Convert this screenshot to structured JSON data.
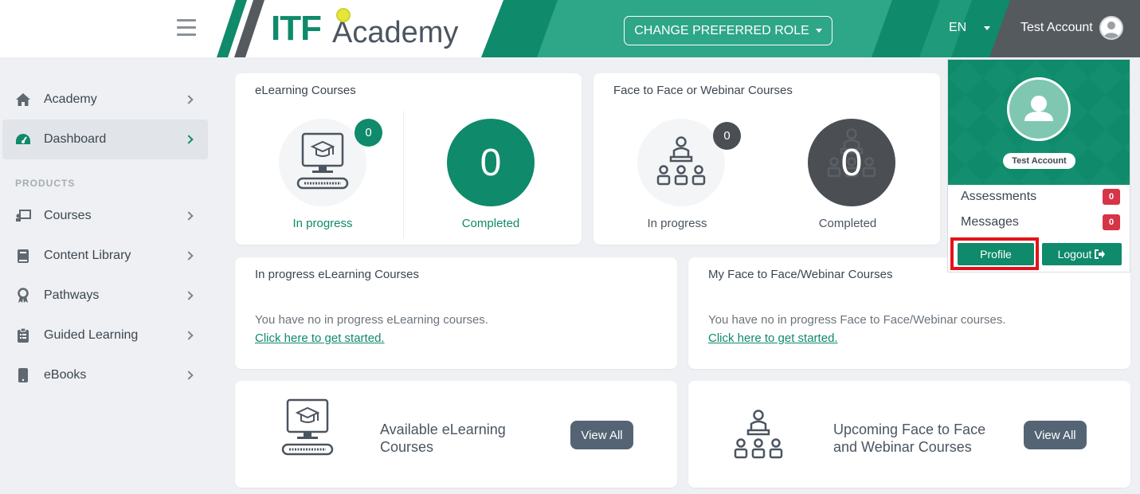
{
  "header": {
    "logo_itf": "ITF",
    "logo_academy": "Academy",
    "role_button": "CHANGE PREFERRED ROLE",
    "language": "EN",
    "account_name": "Test Account",
    "colors": {
      "primary": "#0f8a6a",
      "secondary": "#2ea688",
      "dark": "#555a5f"
    }
  },
  "sidebar": {
    "section_label": "PRODUCTS",
    "items": [
      {
        "label": "Academy",
        "icon": "home-icon"
      },
      {
        "label": "Dashboard",
        "icon": "dashboard-icon"
      },
      {
        "label": "Courses",
        "icon": "courses-icon"
      },
      {
        "label": "Content Library",
        "icon": "book-icon"
      },
      {
        "label": "Pathways",
        "icon": "award-icon"
      },
      {
        "label": "Guided Learning",
        "icon": "clipboard-icon"
      },
      {
        "label": "eBooks",
        "icon": "tablet-icon"
      }
    ]
  },
  "elearning_card": {
    "title": "eLearning Courses",
    "in_progress_count": "0",
    "in_progress_label": "In progress",
    "completed_count": "0",
    "completed_label": "Completed"
  },
  "f2f_card": {
    "title": "Face to Face or Webinar Courses",
    "in_progress_count": "0",
    "in_progress_label": "In progress",
    "completed_count": "0",
    "completed_label": "Completed"
  },
  "inprogress_elearning": {
    "title": "In progress eLearning Courses",
    "message": "You have no in progress eLearning courses.",
    "link": "Click here to get started."
  },
  "my_f2f": {
    "title": "My Face to Face/Webinar Courses",
    "message": "You have no in progress Face to Face/Webinar courses.",
    "link": "Click here to get started."
  },
  "available_elearning": {
    "title": "Available eLearning Courses",
    "button": "View All"
  },
  "upcoming_f2f": {
    "title": "Upcoming Face to Face and Webinar Courses",
    "button": "View All"
  },
  "account_dropdown": {
    "name": "Test Account",
    "assessments_label": "Assessments",
    "assessments_count": "0",
    "messages_label": "Messages",
    "messages_count": "0",
    "profile_button": "Profile",
    "logout_button": "Logout"
  }
}
